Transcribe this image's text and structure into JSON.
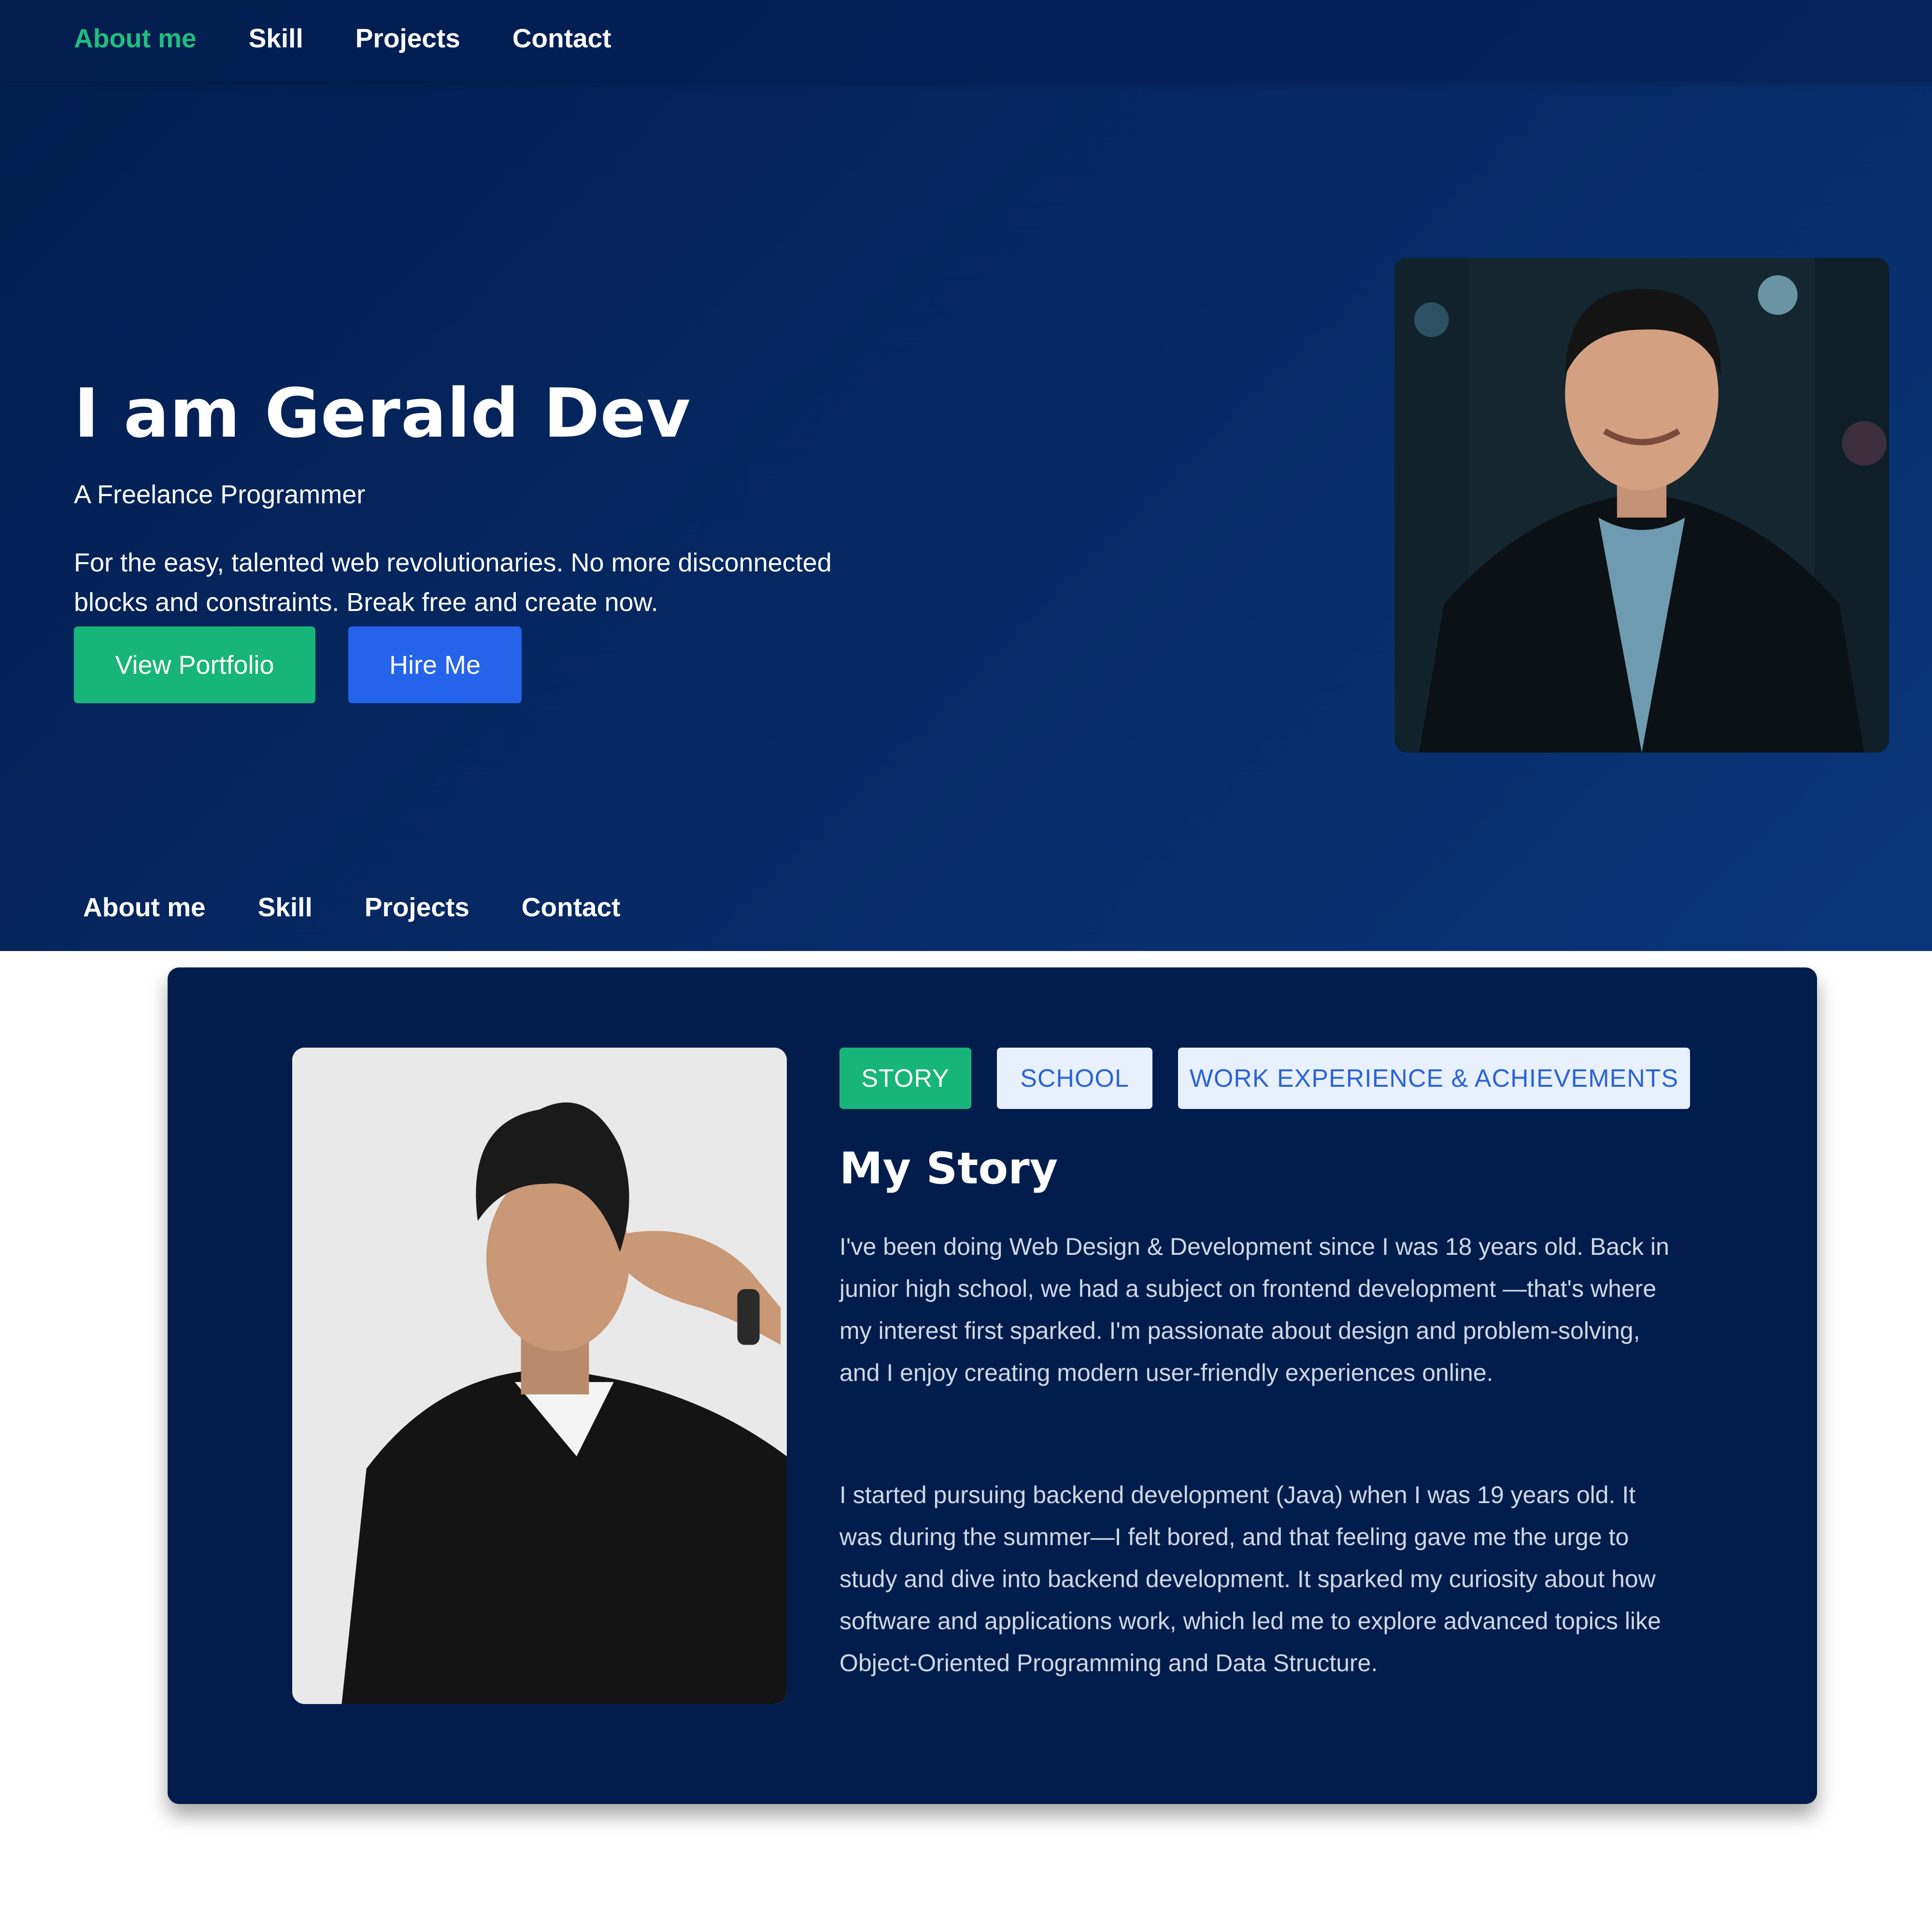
{
  "nav": {
    "items": [
      "About me",
      "Skill",
      "Projects",
      "Contact"
    ],
    "active": "About me",
    "active_color": "#1fbf7f"
  },
  "hero": {
    "title": "I am Gerald Dev",
    "subtitle": "A Freelance Programmer",
    "description": "For the easy, talented web revolutionaries. No more disconnected blocks and constraints. Break free and create now.",
    "buttons": {
      "portfolio": "View Portfolio",
      "hire": "Hire Me"
    },
    "colors": {
      "bg_start": "#031d4f",
      "bg_end": "#0a3679",
      "portfolio_btn": "#17b57a",
      "hire_btn": "#2563eb"
    }
  },
  "about": {
    "tabs": [
      "STORY",
      "SCHOOL",
      "WORK EXPERIENCE & ACHIEVEMENTS"
    ],
    "active_tab": "STORY",
    "title": "My Story",
    "paragraphs": [
      "I've been doing Web Design & Development since I was 18 years old. Back in junior high school, we had a subject on frontend development —that's where my interest first sparked. I'm passionate about design and problem-solving, and I enjoy creating modern user-friendly experiences online.",
      "I started pursuing backend development (Java) when I was 19 years old. It was during the summer—I felt bored, and that feeling gave me the urge to study and dive into backend development. It sparked my curiosity about how software and applications work, which led me to explore advanced topics like Object-Oriented Programming and Data Structure."
    ],
    "colors": {
      "card_bg": "#021d4c",
      "tab_active": "#17b57a",
      "tab_idle_bg": "#e8f0fe",
      "tab_idle_text": "#2a63d8"
    }
  }
}
